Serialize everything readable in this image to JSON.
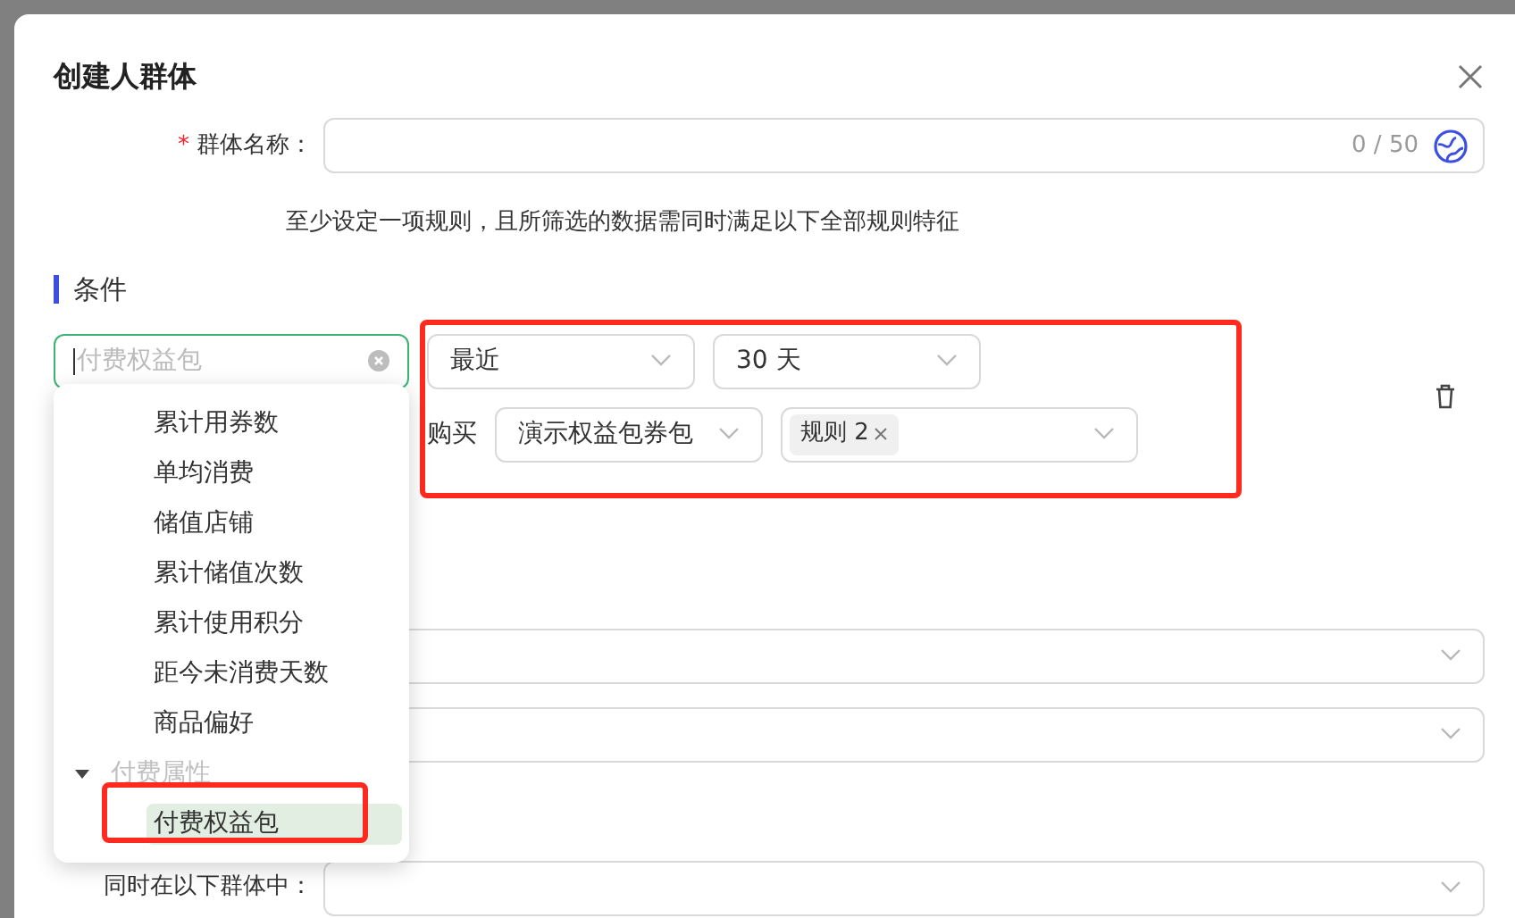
{
  "dialog": {
    "title": "创建人群体"
  },
  "name_field": {
    "label": "群体名称：",
    "required_mark": "*",
    "counter": "0 / 50"
  },
  "hint": "至少设定一项规则，且所筛选的数据需同时满足以下全部规则特征",
  "section": {
    "title": "条件"
  },
  "condition": {
    "field_placeholder": "付费权益包",
    "highlighted": true,
    "period": "最近",
    "days": "30 天",
    "action": "购买",
    "package": "演示权益包券包",
    "tags": [
      {
        "label": "规则 2"
      }
    ]
  },
  "dropdown": {
    "items": [
      {
        "kind": "option",
        "label": "累计用券数",
        "selected": false,
        "highlighted": false
      },
      {
        "kind": "option",
        "label": "单均消费",
        "selected": false,
        "highlighted": false
      },
      {
        "kind": "option",
        "label": "储值店铺",
        "selected": false,
        "highlighted": false
      },
      {
        "kind": "option",
        "label": "累计储值次数",
        "selected": false,
        "highlighted": false
      },
      {
        "kind": "option",
        "label": "累计使用积分",
        "selected": false,
        "highlighted": false
      },
      {
        "kind": "option",
        "label": "距今未消费天数",
        "selected": false,
        "highlighted": false
      },
      {
        "kind": "option",
        "label": "商品偏好",
        "selected": false,
        "highlighted": false
      },
      {
        "kind": "group",
        "label": "付费属性",
        "expanded": true
      },
      {
        "kind": "option",
        "label": "付费权益包",
        "selected": true,
        "highlighted": true
      }
    ]
  },
  "group_field": {
    "label": "同时在以下群体中："
  }
}
